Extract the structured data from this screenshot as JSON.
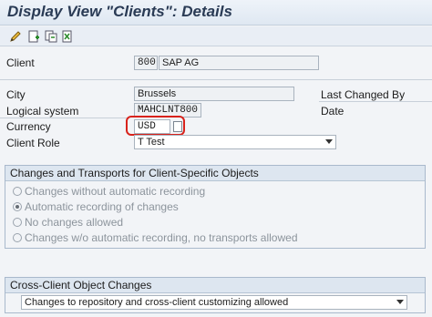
{
  "window": {
    "title": "Display View \"Clients\": Details"
  },
  "toolbar": {
    "icons": [
      "edit-icon",
      "new-entries-icon",
      "copy-icon",
      "delete-icon"
    ]
  },
  "form": {
    "client": {
      "label": "Client",
      "number": "800",
      "name": "SAP AG"
    },
    "city": {
      "label": "City",
      "value": "Brussels"
    },
    "last_changed_by": {
      "label": "Last Changed By"
    },
    "logical_system": {
      "label": "Logical system",
      "value": "MAHCLNT800"
    },
    "date": {
      "label": "Date"
    },
    "currency": {
      "label": "Currency",
      "value": "USD"
    },
    "client_role": {
      "label": "Client Role",
      "value": "T Test"
    }
  },
  "changes_group": {
    "title": "Changes and Transports for Client-Specific Objects",
    "options": [
      {
        "label": "Changes without automatic recording",
        "selected": false
      },
      {
        "label": "Automatic recording of changes",
        "selected": true
      },
      {
        "label": "No changes allowed",
        "selected": false
      },
      {
        "label": "Changes w/o automatic recording, no transports allowed",
        "selected": false
      }
    ]
  },
  "cross_client_group": {
    "title": "Cross-Client Object Changes",
    "value": "Changes to repository and cross-client customizing allowed"
  },
  "colors": {
    "highlight": "#d8221b",
    "title": "#2a3b55"
  }
}
